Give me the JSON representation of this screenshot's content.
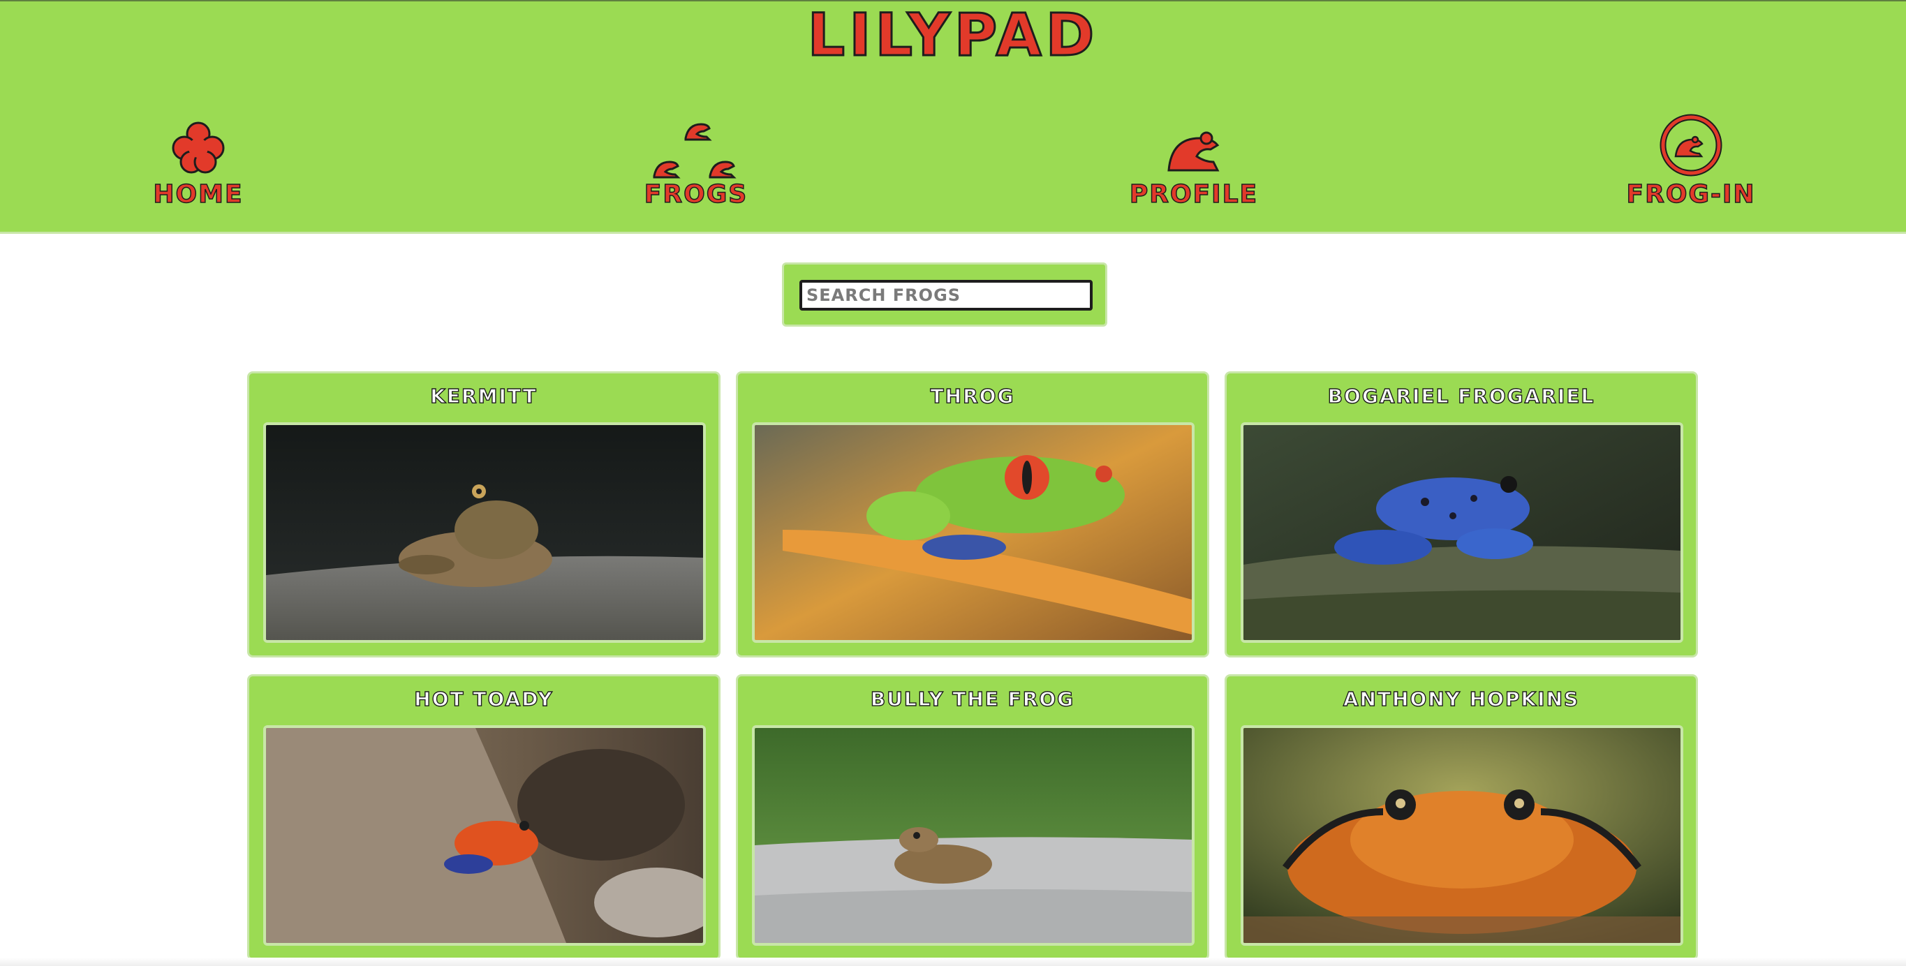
{
  "site": {
    "title": "LILYPAD"
  },
  "nav": [
    {
      "label": "HOME",
      "icon": "clover-icon"
    },
    {
      "label": "FROGS",
      "icon": "frogs-icon"
    },
    {
      "label": "PROFILE",
      "icon": "frog-icon"
    },
    {
      "label": "FROG-IN",
      "icon": "frog-circle-icon"
    }
  ],
  "search": {
    "placeholder": "SEARCH FROGS",
    "value": ""
  },
  "frogs": [
    {
      "name": "KERMITT"
    },
    {
      "name": "THROG"
    },
    {
      "name": "BOGARIEL FROGARIEL"
    },
    {
      "name": "HOT TOADY"
    },
    {
      "name": "BULLY THE FROG"
    },
    {
      "name": "ANTHONY HOPKINS"
    }
  ],
  "colors": {
    "header_green": "#9bdb53",
    "accent_red": "#e23a2a",
    "outline": "#1d1d1d"
  }
}
